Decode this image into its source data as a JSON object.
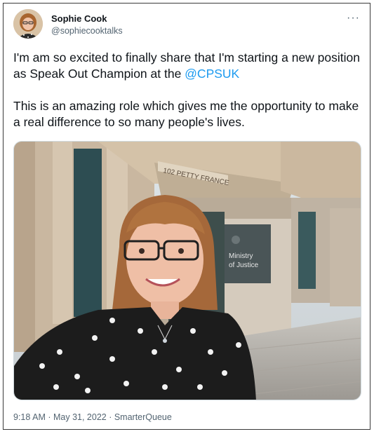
{
  "author": {
    "name": "Sophie Cook",
    "handle": "@sophiecooktalks"
  },
  "more_label": "···",
  "tweet": {
    "text_part1": "I'm am so excited to finally share that I'm starting a new position as Speak Out Champion at the ",
    "mention": "@CPSUK",
    "text_part2": "This is an amazing role which gives me the opportunity to make a real difference to so many people's lives."
  },
  "photo": {
    "building_sign": "102 PETTY FRANCE",
    "plaque_line1": "Ministry",
    "plaque_line2": "of Justice"
  },
  "meta": {
    "time": "9:18 AM",
    "separator": " · ",
    "date": "May 31, 2022",
    "source": "SmarterQueue"
  },
  "colors": {
    "link": "#1d9bf0",
    "secondary_text": "#536471",
    "primary_text": "#0f1419"
  }
}
